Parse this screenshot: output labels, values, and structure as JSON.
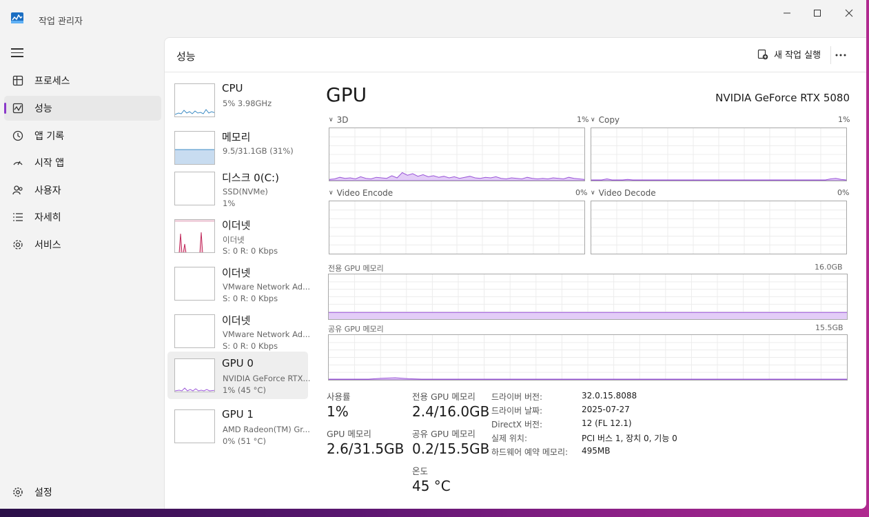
{
  "window": {
    "title": "작업 관리자"
  },
  "sidebar": {
    "items": [
      {
        "label": "프로세스",
        "icon": "processes-icon"
      },
      {
        "label": "성능",
        "icon": "performance-icon"
      },
      {
        "label": "앱 기록",
        "icon": "history-icon"
      },
      {
        "label": "시작 앱",
        "icon": "startup-icon"
      },
      {
        "label": "사용자",
        "icon": "users-icon"
      },
      {
        "label": "자세히",
        "icon": "details-icon"
      },
      {
        "label": "서비스",
        "icon": "services-icon"
      }
    ],
    "settings_label": "설정"
  },
  "header": {
    "title": "성능",
    "new_task": "새 작업 실행"
  },
  "devices": [
    {
      "name": "CPU",
      "sub1": "5%  3.98GHz",
      "sub2": ""
    },
    {
      "name": "메모리",
      "sub1": "9.5/31.1GB (31%)",
      "sub2": ""
    },
    {
      "name": "디스크 0(C:)",
      "sub1": "SSD(NVMe)",
      "sub2": "1%"
    },
    {
      "name": "이더넷",
      "sub1": "이더넷",
      "sub2": "S: 0  R: 0 Kbps"
    },
    {
      "name": "이더넷",
      "sub1": "VMware Network Ad...",
      "sub2": "S: 0  R: 0 Kbps"
    },
    {
      "name": "이더넷",
      "sub1": "VMware Network Ad...",
      "sub2": "S: 0  R: 0 Kbps"
    },
    {
      "name": "GPU 0",
      "sub1": "NVIDIA GeForce RTX...",
      "sub2": "1% (45 °C)"
    },
    {
      "name": "GPU 1",
      "sub1": "AMD Radeon(TM) Gr...",
      "sub2": "0% (51 °C)"
    }
  ],
  "gpu": {
    "title": "GPU",
    "model": "NVIDIA GeForce RTX 5080",
    "engines": [
      {
        "label": "3D",
        "pct": "1%"
      },
      {
        "label": "Copy",
        "pct": "1%"
      },
      {
        "label": "Video Encode",
        "pct": "0%"
      },
      {
        "label": "Video Decode",
        "pct": "0%"
      }
    ],
    "dedicated": {
      "label": "전용 GPU 메모리",
      "max": "16.0GB"
    },
    "shared": {
      "label": "공유 GPU 메모리",
      "max": "15.5GB"
    },
    "stats": {
      "usage_label": "사용률",
      "usage": "1%",
      "gpu_mem_label": "GPU 메모리",
      "gpu_mem": "2.6/31.5GB",
      "ded_label": "전용 GPU 메모리",
      "ded": "2.4/16.0GB",
      "shared_label": "공유 GPU 메모리",
      "shared": "0.2/15.5GB",
      "temp_label": "온도",
      "temp": "45 °C"
    },
    "info": [
      {
        "key": "드라이버 버전:",
        "value": "32.0.15.8088"
      },
      {
        "key": "드라이버 날짜:",
        "value": "2025-07-27"
      },
      {
        "key": "DirectX 버전:",
        "value": "12 (FL 12.1)"
      },
      {
        "key": "실제 위치:",
        "value": "PCI 버스 1, 장치 0, 기능 0"
      },
      {
        "key": "하드웨어 예약 메모리:",
        "value": "495MB"
      }
    ]
  },
  "colors": {
    "accent": "#8a39c9",
    "gpu_line": "#9a55d8",
    "net_line": "#c0285a",
    "cpu_line": "#3d8cc4"
  }
}
